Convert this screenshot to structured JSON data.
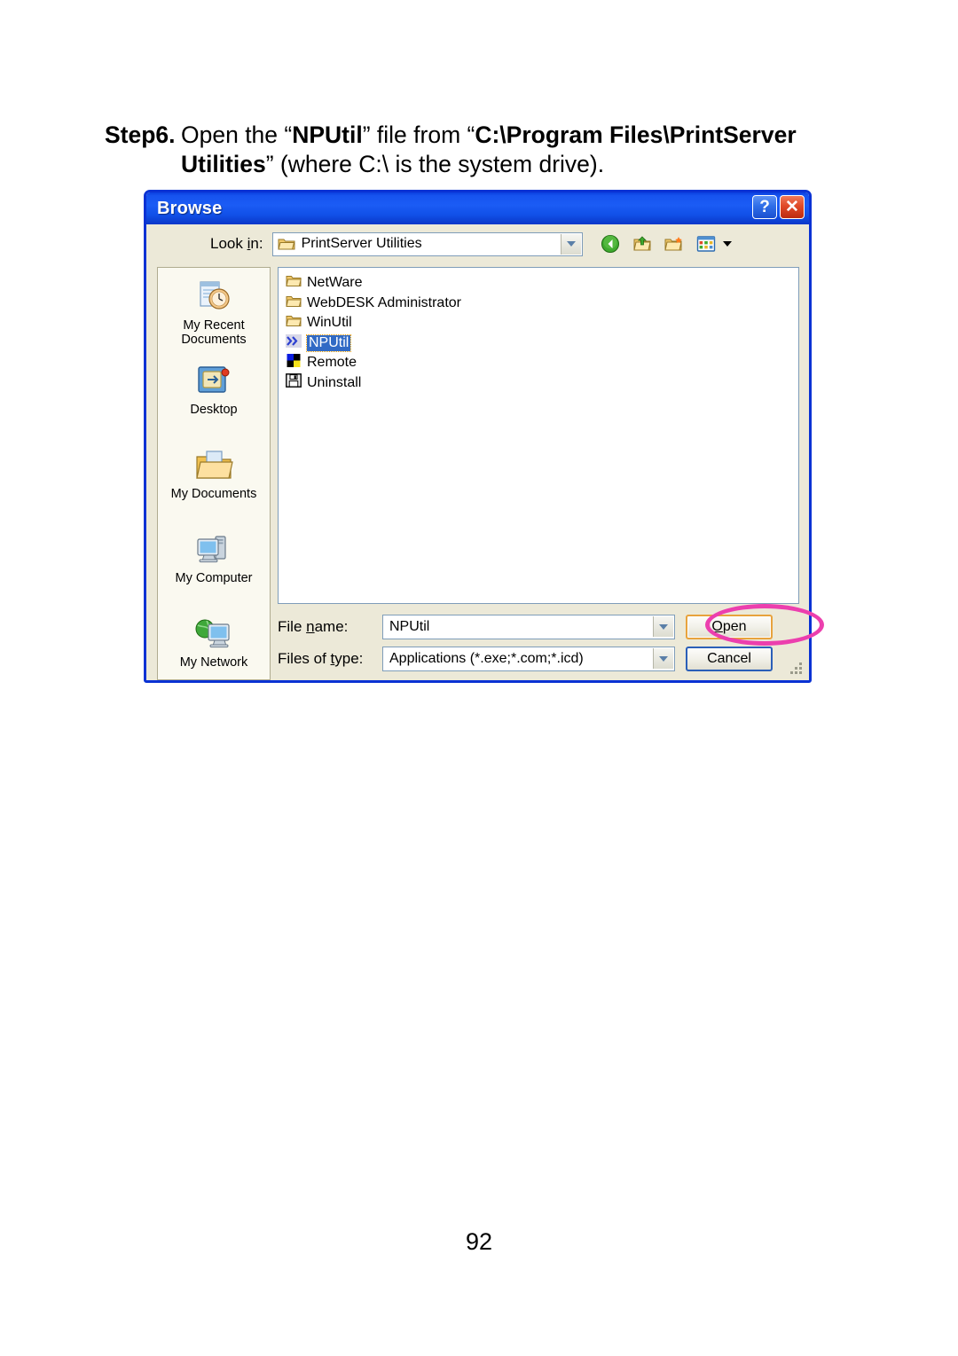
{
  "document": {
    "page_number": "92",
    "step": {
      "label": "Step6.",
      "line1_pre": "Open the “",
      "line1_bold1": "NPUtil",
      "line1_mid": "” file from “",
      "line1_bold2": "C:\\Program Files\\PrintServer",
      "line2_bold": "Utilities",
      "line2_post": "” (where C:\\ is the system drive)."
    }
  },
  "dialog": {
    "title": "Browse",
    "titlebar_buttons": [
      {
        "name": "help-button",
        "glyph": "?"
      },
      {
        "name": "close-button",
        "glyph": "✕"
      }
    ],
    "lookin": {
      "label_pre": "Look ",
      "label_underline": "i",
      "label_post": "n:",
      "value": "PrintServer Utilities",
      "icon": "folder-open-icon"
    },
    "toolbar": [
      {
        "name": "back-button",
        "icon": "back-arrow-icon"
      },
      {
        "name": "up-one-level-button",
        "icon": "up-folder-icon"
      },
      {
        "name": "create-new-folder-button",
        "icon": "new-folder-icon"
      },
      {
        "name": "views-button",
        "icon": "views-icon"
      }
    ],
    "places": [
      {
        "name": "my-recent-documents",
        "label": "My Recent\nDocuments",
        "icon": "recent-documents-icon"
      },
      {
        "name": "desktop",
        "label": "Desktop",
        "icon": "desktop-icon"
      },
      {
        "name": "my-documents",
        "label": "My Documents",
        "icon": "my-documents-icon"
      },
      {
        "name": "my-computer",
        "label": "My Computer",
        "icon": "my-computer-icon"
      },
      {
        "name": "my-network",
        "label": "My Network",
        "icon": "my-network-icon"
      }
    ],
    "files": [
      {
        "name": "NetWare",
        "icon": "folder-icon",
        "selected": false
      },
      {
        "name": "WebDESK Administrator",
        "icon": "folder-icon",
        "selected": false
      },
      {
        "name": "WinUtil",
        "icon": "folder-icon",
        "selected": false
      },
      {
        "name": "NPUtil",
        "icon": "chevrons-app-icon",
        "selected": true
      },
      {
        "name": "Remote",
        "icon": "four-color-squares-icon",
        "selected": false
      },
      {
        "name": "Uninstall",
        "icon": "floppy-disk-icon",
        "selected": false
      }
    ],
    "file_name": {
      "label_pre": "File ",
      "label_underline": "n",
      "label_post": "ame:",
      "value": "NPUtil"
    },
    "files_of_type": {
      "label_pre": "Files of ",
      "label_underline": "t",
      "label_post": "ype:",
      "value": "Applications (*.exe;*.com;*.icd)"
    },
    "buttons": {
      "open": {
        "pre": "",
        "underline": "O",
        "post": "pen"
      },
      "cancel": "Cancel"
    }
  },
  "annotation": {
    "highlight_shape": "ellipse",
    "highlight_color": "#ec3fae",
    "highlight_target": "open-button"
  },
  "colors": {
    "titlebar_blue": "#1653ef",
    "dialog_face": "#ece9d8",
    "dialog_border": "#0a32d4",
    "selection_blue": "#316ac5",
    "focus_orange": "#e8a33d",
    "places_bg": "#faf9f0",
    "highlight_pink": "#ec3fae"
  }
}
